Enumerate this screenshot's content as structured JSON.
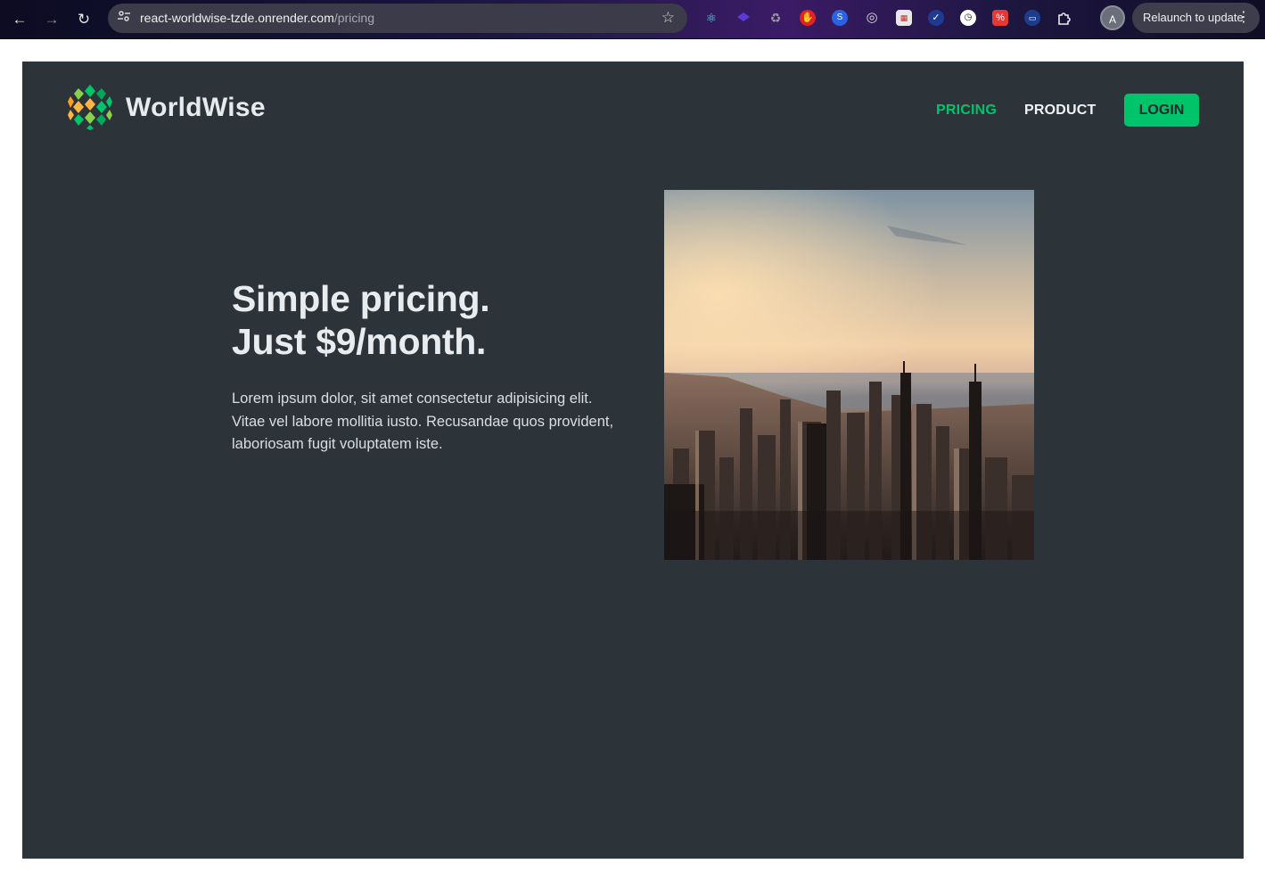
{
  "browser": {
    "url_host": "react-worldwise-tzde.onrender.com",
    "url_path": "/pricing",
    "profile_initial": "A",
    "relaunch_label": "Relaunch to update",
    "extensions": [
      "react-devtools-icon",
      "layers-icon",
      "recycle-icon",
      "shield-red-icon",
      "blue-s-icon",
      "target-icon",
      "calendar-icon",
      "check-icon",
      "history-icon",
      "percent-icon",
      "chat-icon",
      "puzzle-icon"
    ]
  },
  "site": {
    "brand": "WorldWise",
    "nav": {
      "pricing": "PRICING",
      "product": "PRODUCT",
      "login": "LOGIN"
    },
    "hero": {
      "title_line1": "Simple pricing.",
      "title_line2": "Just $9/month.",
      "body": "Lorem ipsum dolor, sit amet consectetur adipisicing elit. Vitae vel labore mollitia iusto. Recusandae quos provident, laboriosam fugit voluptatem iste."
    }
  },
  "colors": {
    "accent": "#00c46a",
    "page_background": "#2d3439",
    "text": "#e8ecee"
  }
}
